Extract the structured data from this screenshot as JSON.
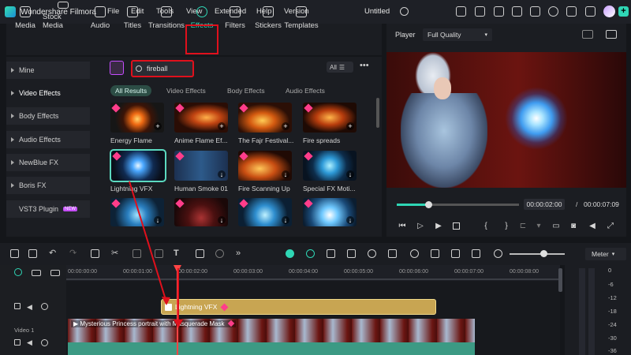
{
  "titlebar": {
    "app_name": "Wondershare Filmora",
    "menus": [
      "File",
      "Edit",
      "Tools",
      "View",
      "Extended",
      "Help",
      "Version"
    ],
    "document": "Untitled"
  },
  "tabs": [
    {
      "label": "Media",
      "icon": "media-icon"
    },
    {
      "label": "Stock Media",
      "icon": "stock-media-icon"
    },
    {
      "label": "Audio",
      "icon": "audio-icon"
    },
    {
      "label": "Titles",
      "icon": "titles-icon"
    },
    {
      "label": "Transitions",
      "icon": "transitions-icon"
    },
    {
      "label": "Effects",
      "icon": "effects-icon",
      "active": true
    },
    {
      "label": "Filters",
      "icon": "filters-icon"
    },
    {
      "label": "Stickers",
      "icon": "stickers-icon"
    },
    {
      "label": "Templates",
      "icon": "templates-icon"
    }
  ],
  "sidebar": {
    "items": [
      {
        "label": "Mine"
      },
      {
        "label": "Video Effects",
        "selected": true
      },
      {
        "label": "Body Effects"
      },
      {
        "label": "Audio Effects"
      },
      {
        "label": "NewBlue FX"
      },
      {
        "label": "Boris FX"
      },
      {
        "label": "VST3 Plugin",
        "badge": "NEW"
      }
    ]
  },
  "search": {
    "value": "fireball",
    "filter": "All"
  },
  "filter_pills": [
    "All Results",
    "Video Effects",
    "Body Effects",
    "Audio Effects"
  ],
  "effects": [
    {
      "label": "Energy Flame"
    },
    {
      "label": "Anime Flame Ef..."
    },
    {
      "label": "The Fajr Festival..."
    },
    {
      "label": "Fire spreads"
    },
    {
      "label": "Lightning VFX",
      "selected": true
    },
    {
      "label": "Human Smoke 01"
    },
    {
      "label": "Fire Scanning Up"
    },
    {
      "label": "Special FX Moti..."
    },
    {
      "label": ""
    },
    {
      "label": ""
    },
    {
      "label": ""
    },
    {
      "label": ""
    }
  ],
  "player": {
    "label": "Player",
    "quality": "Full Quality",
    "current_time": "00:00:02:00",
    "separator": "/",
    "total_time": "00:00:07:09",
    "progress": 0.26
  },
  "timeline": {
    "ruler": [
      "00:00:00:00",
      "00:00:01:00",
      "00:00:02:00",
      "00:00:03:00",
      "00:00:04:00",
      "00:00:05:00",
      "00:00:06:00",
      "00:00:07:00",
      "00:00:08:00"
    ],
    "fx_clip": "Lightning VFX",
    "video_clip": "Mysterious Princess portrait with Masquerade Mask",
    "video_track": "Video 1"
  },
  "meter": {
    "label": "Meter",
    "scale": [
      "0",
      "-6",
      "-12",
      "-18",
      "-24",
      "-30",
      "-36"
    ]
  },
  "colors": {
    "accent": "#2fd6b5",
    "highlight": "#e0101c",
    "clip_fx": "#c8a552",
    "playhead": "#ff4545"
  }
}
